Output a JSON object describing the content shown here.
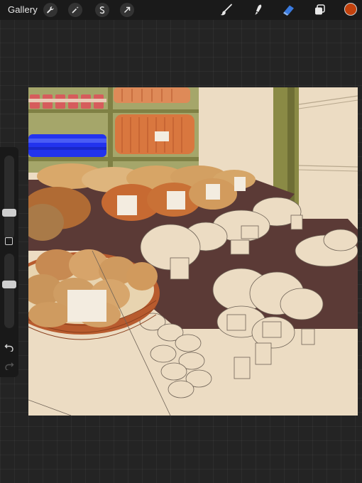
{
  "toolbar": {
    "gallery_label": "Gallery",
    "left_tools": [
      "wrench-icon",
      "magic-wand-icon",
      "selection-icon",
      "transform-arrow-icon"
    ],
    "right_tools": [
      "brush-icon",
      "smudge-icon",
      "eraser-icon",
      "layers-icon"
    ],
    "active_tool": "eraser-icon",
    "accent_color": "#3a7be0",
    "current_color": "#c2410c"
  },
  "sidebar": {
    "brush_size_level": 0.3,
    "opacity_level": 0.6
  },
  "canvas": {
    "background_color": "#ecdcc3"
  }
}
